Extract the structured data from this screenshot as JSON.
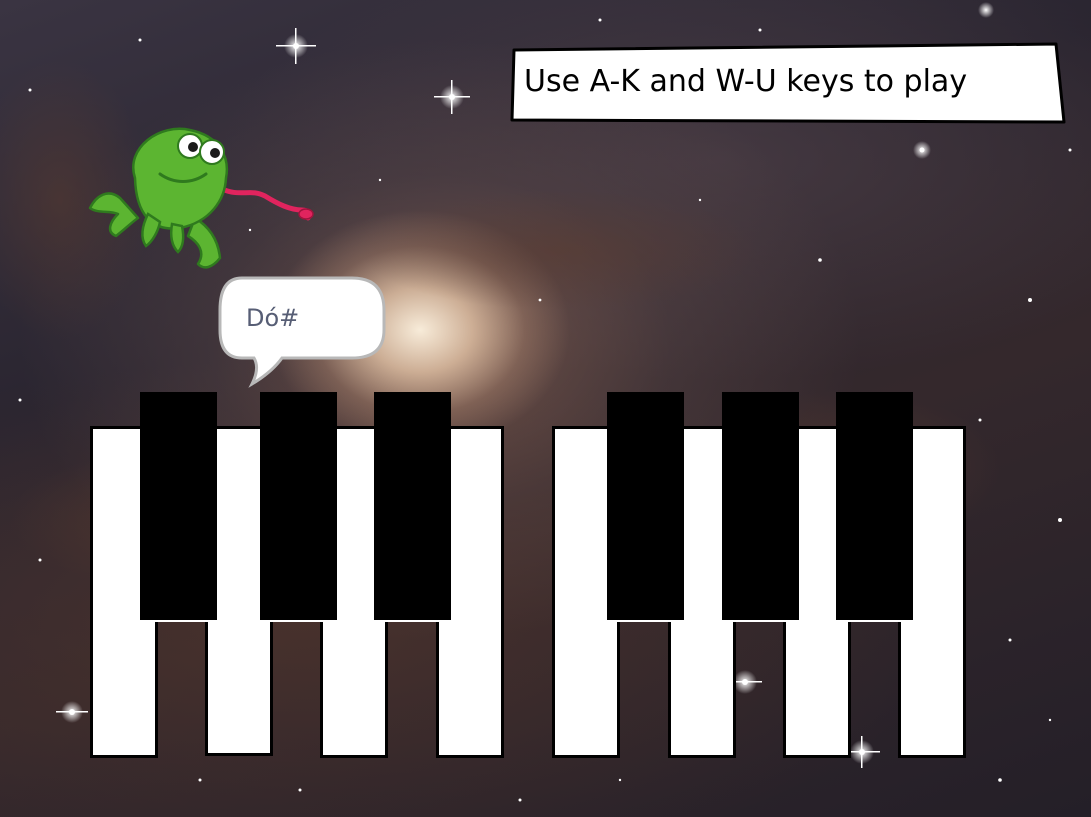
{
  "hint": {
    "text": "Use A-K and W-U keys to play"
  },
  "speech_bubble": {
    "text": "Dó#"
  },
  "sprite": {
    "icon": "frog-icon",
    "color": "#5cb531",
    "tongue_color": "#e0245e"
  },
  "piano": {
    "octaves": 2,
    "white_keys_per_octave": 4,
    "black_keys_per_octave": 3,
    "white_key_color": "#ffffff",
    "black_key_color": "#000000"
  },
  "background": {
    "icon": "galaxy-backdrop"
  }
}
